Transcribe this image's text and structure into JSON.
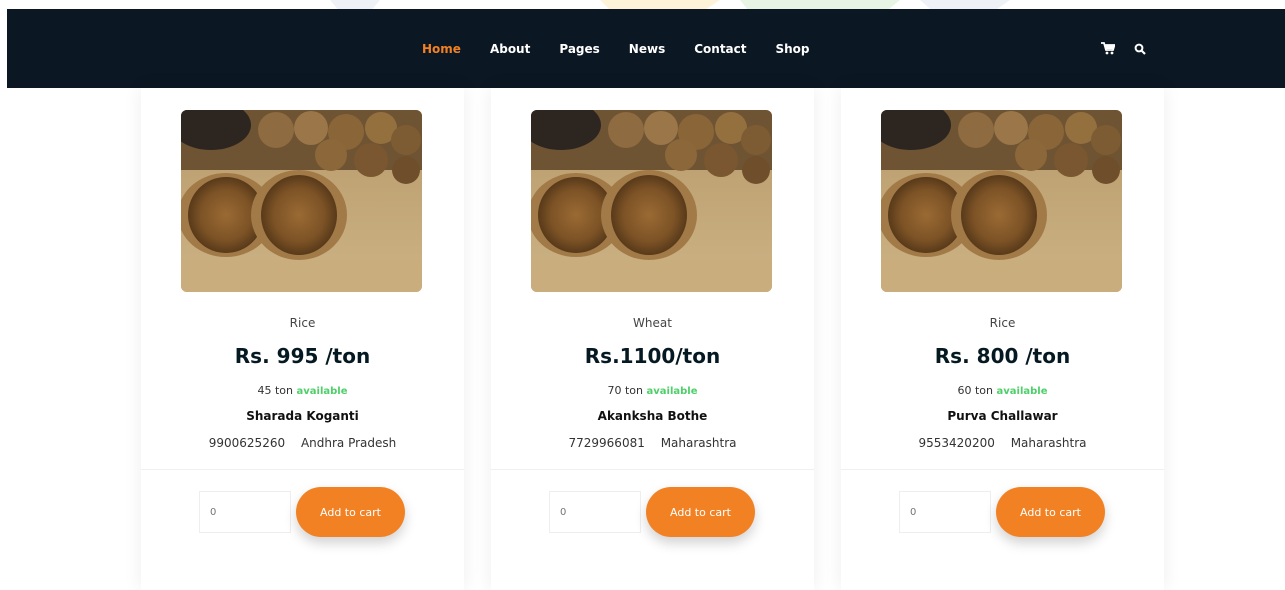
{
  "nav": {
    "links": [
      {
        "label": "Home",
        "active": true
      },
      {
        "label": "About"
      },
      {
        "label": "Pages"
      },
      {
        "label": "News"
      },
      {
        "label": "Contact"
      },
      {
        "label": "Shop"
      }
    ],
    "icons": [
      "cart-icon",
      "search-icon"
    ]
  },
  "colors": {
    "navbar_bg": "#0b1722",
    "accent": "#f28123",
    "available": "#4fcf6a",
    "price": "#051922"
  },
  "products": [
    {
      "name": "Rice",
      "price": "Rs. 995 /ton",
      "quantity": "45",
      "unit": "ton",
      "availability": "available",
      "seller": "Sharada Koganti",
      "phone": "9900625260",
      "location": "Andhra Pradesh",
      "qty_value": "0",
      "button_label": "Add to cart"
    },
    {
      "name": "Wheat",
      "price": "Rs.1100/ton",
      "quantity": "70",
      "unit": "ton",
      "availability": "available",
      "seller": "Akanksha Bothe",
      "phone": "7729966081",
      "location": "Maharashtra",
      "qty_value": "0",
      "button_label": "Add to cart"
    },
    {
      "name": "Rice",
      "price": "Rs. 800 /ton",
      "quantity": "60",
      "unit": "ton",
      "availability": "available",
      "seller": "Purva Challawar",
      "phone": "9553420200",
      "location": "Maharashtra",
      "qty_value": "0",
      "button_label": "Add to cart"
    }
  ]
}
